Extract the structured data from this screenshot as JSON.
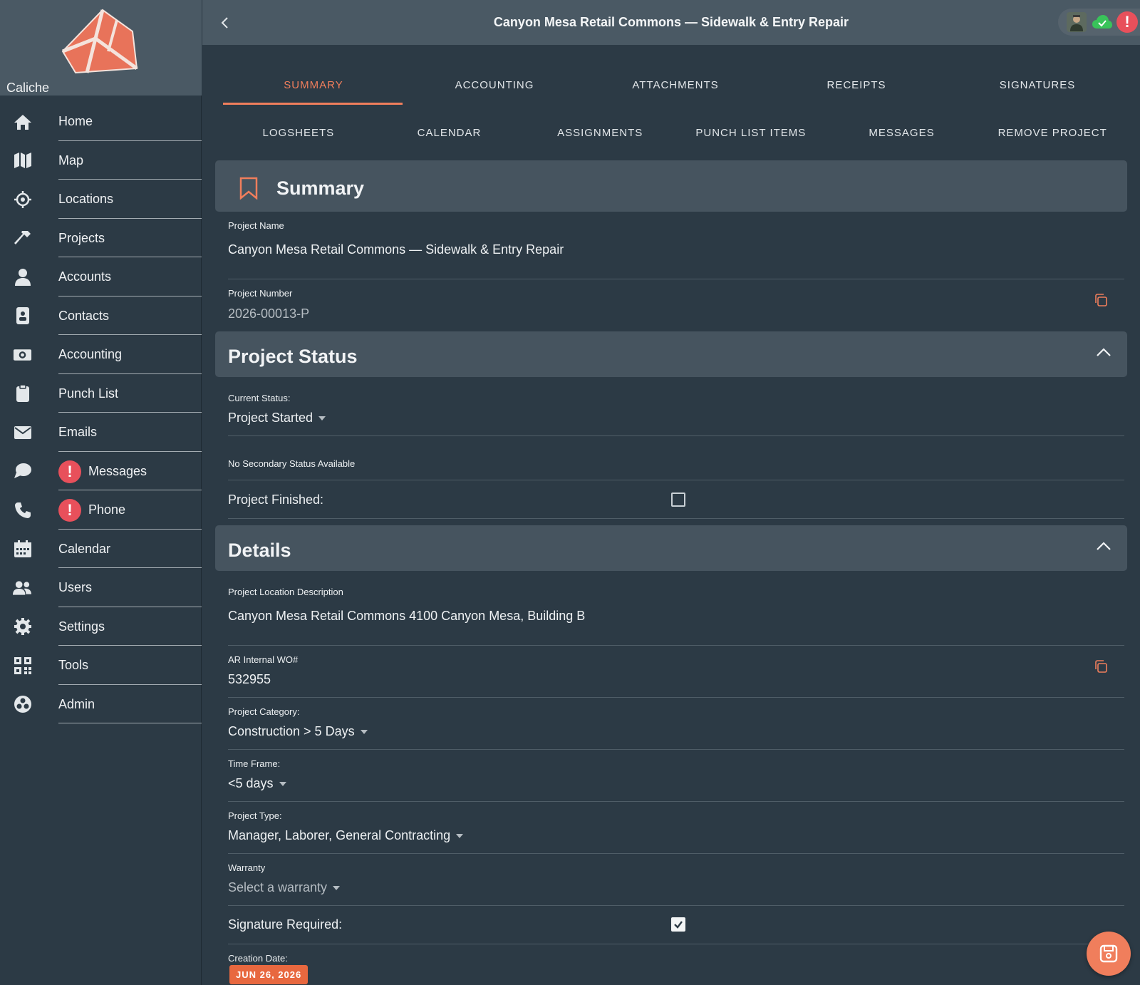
{
  "brand": {
    "name": "Caliche",
    "accent": "#e8735a"
  },
  "header": {
    "title": "Canyon Mesa Retail Commons — Sidewalk & Entry Repair",
    "alert_glyph": "!"
  },
  "sidebar": {
    "items": [
      {
        "label": "Home",
        "icon": "home-icon"
      },
      {
        "label": "Map",
        "icon": "map-icon"
      },
      {
        "label": "Locations",
        "icon": "crosshair-icon"
      },
      {
        "label": "Projects",
        "icon": "hammer-icon"
      },
      {
        "label": "Accounts",
        "icon": "person-icon"
      },
      {
        "label": "Contacts",
        "icon": "contact-card-icon"
      },
      {
        "label": "Accounting",
        "icon": "money-icon"
      },
      {
        "label": "Punch List",
        "icon": "clipboard-icon"
      },
      {
        "label": "Emails",
        "icon": "envelope-icon"
      },
      {
        "label": "Messages",
        "icon": "chat-icon",
        "alert": "!"
      },
      {
        "label": "Phone",
        "icon": "phone-icon",
        "alert": "!"
      },
      {
        "label": "Calendar",
        "icon": "calendar-icon"
      },
      {
        "label": "Users",
        "icon": "users-icon"
      },
      {
        "label": "Settings",
        "icon": "gear-icon"
      },
      {
        "label": "Tools",
        "icon": "qr-code-icon"
      },
      {
        "label": "Admin",
        "icon": "admin-icon"
      }
    ]
  },
  "tabs_row1": [
    "SUMMARY",
    "ACCOUNTING",
    "ATTACHMENTS",
    "RECEIPTS",
    "SIGNATURES"
  ],
  "tabs_row2": [
    "LOGSHEETS",
    "CALENDAR",
    "ASSIGNMENTS",
    "PUNCH LIST ITEMS",
    "MESSAGES",
    "REMOVE PROJECT"
  ],
  "active_tab": "SUMMARY",
  "summary": {
    "title": "Summary",
    "project_name_label": "Project Name",
    "project_name": "Canyon Mesa Retail Commons — Sidewalk & Entry Repair",
    "project_number_label": "Project Number",
    "project_number": "2026-00013-P"
  },
  "status": {
    "title": "Project Status",
    "current_label": "Current Status:",
    "current_value": "Project Started",
    "secondary_text": "No Secondary Status Available",
    "finished_label": "Project Finished:",
    "finished_checked": false
  },
  "details": {
    "title": "Details",
    "location_label": "Project Location Description",
    "location_value": "Canyon Mesa Retail Commons 4100 Canyon Mesa, Building B",
    "wo_label": "AR Internal WO#",
    "wo_value": "532955",
    "category_label": "Project Category:",
    "category_value": "Construction > 5 Days",
    "timeframe_label": "Time Frame:",
    "timeframe_value": "<5 days",
    "type_label": "Project Type:",
    "type_value": "Manager, Laborer, General Contracting",
    "warranty_label": "Warranty",
    "warranty_placeholder": "Select a warranty",
    "signature_label": "Signature Required:",
    "signature_checked": true,
    "creation_label": "Creation Date:",
    "creation_value": "JUN 26, 2026"
  }
}
